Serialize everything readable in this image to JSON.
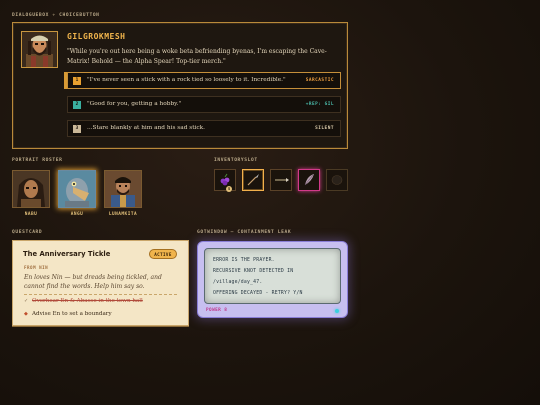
{
  "sections": {
    "dialogue": {
      "left": "DIALOGUEBOX",
      "sep": "+",
      "right": "CHOICEBUTTON"
    },
    "roster": "PORTRAIT ROSTER",
    "inventory": "INVENTORYSLOT",
    "quest": "QUESTCARD",
    "terminal": "GOTWINDOW — CONTAINMENT LEAK"
  },
  "dialogue": {
    "speaker": "GILGROKMESH",
    "speaker_portrait": "bearded-warrior-portrait",
    "text": "\"While you're out here being a woke beta befriending byenas, I'm escaping the Cave-Matrix! Behold — the Alpha Spear! Top-tier merch.\"",
    "choices": [
      {
        "num": "1",
        "text": "\"I've never seen a stick with a rock tied so loosely to it. Incredible.\"",
        "tag": "SARCASTIC",
        "tag_color": "#f0a040",
        "num_bg": "#e8a030",
        "selected": true
      },
      {
        "num": "2",
        "text": "\"Good for you, getting a hobby.\"",
        "tag": "+REP: GIL",
        "tag_color": "#4ab8a8",
        "num_bg": "#3ab0a0",
        "selected": false
      },
      {
        "num": "3",
        "text": "...Stare blankly at him and his sad stick.",
        "tag": "SILENT",
        "tag_color": "#d8c8a8",
        "num_bg": "#cbb898",
        "selected": false
      }
    ]
  },
  "roster": [
    {
      "name": "NABU",
      "portrait": "hooded-woman-portrait",
      "active": false
    },
    {
      "name": "ANGU",
      "portrait": "shoebill-bird-portrait",
      "active": true
    },
    {
      "name": "LUNAMKITA",
      "portrait": "robed-man-portrait",
      "active": false
    }
  ],
  "inventory": [
    {
      "icon": "berries-icon",
      "count": "5",
      "state": "normal"
    },
    {
      "icon": "spear-icon",
      "count": "",
      "state": "selected"
    },
    {
      "icon": "arrow-icon",
      "count": "",
      "state": "normal"
    },
    {
      "icon": "feather-icon",
      "count": "",
      "state": "rare"
    },
    {
      "icon": "stone-icon",
      "count": "",
      "state": "dim"
    }
  ],
  "quest": {
    "title": "The Anniversary Tickle",
    "status": "ACTIVE",
    "from": "FROM NIN",
    "desc": "En loves Nin — but dreads being tickled, and cannot find the words. Help him say so.",
    "objectives": [
      {
        "text": "Overhear En & Abasse in the town hall",
        "done": true
      },
      {
        "text": "Advise En to set a boundary",
        "done": false
      }
    ]
  },
  "terminal": {
    "lines": [
      "ERROR IS THE PRAYER.",
      "RECURSIVE KNOT DETECTED IN",
      "/village/day_47.",
      "OFFERING DECAYED - RETRY? Y/N"
    ],
    "power": "POWER 8"
  }
}
